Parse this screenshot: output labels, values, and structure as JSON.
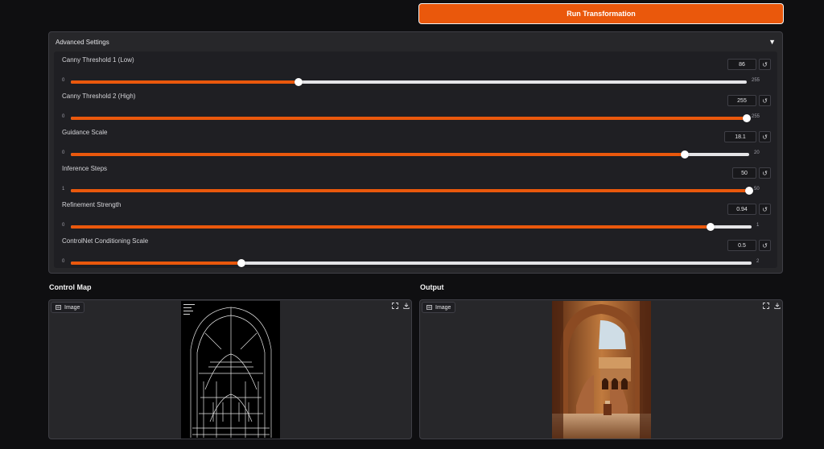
{
  "run_button": {
    "label": "Run Transformation"
  },
  "advanced": {
    "title": "Advanced Settings",
    "toggle_glyph": "▼",
    "sliders": [
      {
        "label": "Canny Threshold 1 (Low)",
        "value": "86",
        "min": "0",
        "max": "255",
        "fraction": 0.337
      },
      {
        "label": "Canny Threshold 2 (High)",
        "value": "255",
        "min": "0",
        "max": "255",
        "fraction": 1.0
      },
      {
        "label": "Guidance Scale",
        "value": "18.1",
        "min": "0",
        "max": "20",
        "fraction": 0.905
      },
      {
        "label": "Inference Steps",
        "value": "50",
        "min": "1",
        "max": "50",
        "fraction": 1.0
      },
      {
        "label": "Refinement Strength",
        "value": "0.94",
        "min": "0",
        "max": "1",
        "fraction": 0.94
      },
      {
        "label": "ControlNet Conditioning Scale",
        "value": "0.5",
        "min": "0",
        "max": "2",
        "fraction": 0.25
      }
    ]
  },
  "control_map": {
    "title": "Control Map",
    "tag": "Image"
  },
  "output": {
    "title": "Output",
    "tag": "Image"
  },
  "colors": {
    "accent": "#ea580c",
    "track": "#e4e4e7",
    "panel": "#27272a",
    "background": "#0f0f11"
  },
  "icons": {
    "reset": "reset-icon",
    "fullscreen": "fullscreen-icon",
    "download": "download-icon",
    "image_tag": "image-icon"
  }
}
